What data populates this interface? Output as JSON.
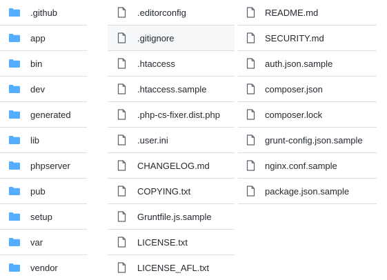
{
  "colors": {
    "folder": "#54aeff",
    "file_icon_stroke": "#57606a",
    "text": "#24292f",
    "row_divider": "#d8dee4",
    "selected_row_bg": "#f6f8fa"
  },
  "folders": [
    {
      "name": ".github",
      "icon": "folder-icon"
    },
    {
      "name": "app",
      "icon": "folder-icon"
    },
    {
      "name": "bin",
      "icon": "folder-icon"
    },
    {
      "name": "dev",
      "icon": "folder-icon"
    },
    {
      "name": "generated",
      "icon": "folder-icon"
    },
    {
      "name": "lib",
      "icon": "folder-icon"
    },
    {
      "name": "phpserver",
      "icon": "folder-icon"
    },
    {
      "name": "pub",
      "icon": "folder-icon"
    },
    {
      "name": "setup",
      "icon": "folder-icon"
    },
    {
      "name": "var",
      "icon": "folder-icon"
    },
    {
      "name": "vendor",
      "icon": "folder-icon"
    }
  ],
  "files_col2": [
    {
      "name": ".editorconfig",
      "icon": "file-icon"
    },
    {
      "name": ".gitignore",
      "icon": "file-icon",
      "selected": true
    },
    {
      "name": ".htaccess",
      "icon": "file-icon"
    },
    {
      "name": ".htaccess.sample",
      "icon": "file-icon"
    },
    {
      "name": ".php-cs-fixer.dist.php",
      "icon": "file-icon"
    },
    {
      "name": ".user.ini",
      "icon": "file-icon"
    },
    {
      "name": "CHANGELOG.md",
      "icon": "file-icon"
    },
    {
      "name": "COPYING.txt",
      "icon": "file-icon"
    },
    {
      "name": "Gruntfile.js.sample",
      "icon": "file-icon"
    },
    {
      "name": "LICENSE.txt",
      "icon": "file-icon"
    },
    {
      "name": "LICENSE_AFL.txt",
      "icon": "file-icon"
    }
  ],
  "files_col3": [
    {
      "name": "README.md",
      "icon": "file-icon"
    },
    {
      "name": "SECURITY.md",
      "icon": "file-icon"
    },
    {
      "name": "auth.json.sample",
      "icon": "file-icon"
    },
    {
      "name": "composer.json",
      "icon": "file-icon"
    },
    {
      "name": "composer.lock",
      "icon": "file-icon"
    },
    {
      "name": "grunt-config.json.sample",
      "icon": "file-icon"
    },
    {
      "name": "nginx.conf.sample",
      "icon": "file-icon"
    },
    {
      "name": "package.json.sample",
      "icon": "file-icon"
    }
  ]
}
